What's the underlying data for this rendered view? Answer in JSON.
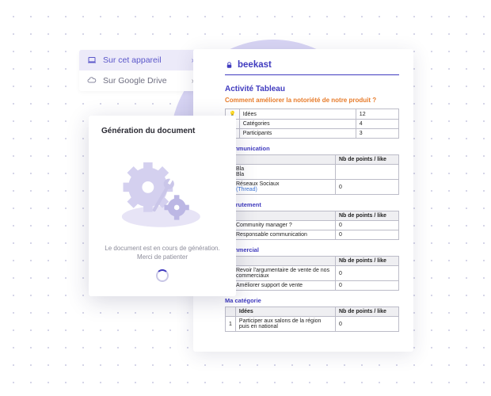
{
  "export": {
    "device_label": "Sur cet appareil",
    "drive_label": "Sur Google Drive"
  },
  "brand": "beekast",
  "activity": {
    "title": "Activité Tableau",
    "question": "Comment améliorer la notoriété de notre produit ?",
    "summary": [
      {
        "label": "Idées",
        "value": "12"
      },
      {
        "label": "Catégories",
        "value": "4"
      },
      {
        "label": "Participants",
        "value": "3"
      }
    ],
    "points_col": "Nb de points / like",
    "idea_col": "Idées",
    "categories": [
      {
        "name": "Communication",
        "rows": [
          {
            "idea": "Bla\nBla",
            "points": ""
          },
          {
            "idea": "Réseaux Sociaux",
            "points": "0",
            "link": "(Thread)"
          }
        ]
      },
      {
        "name": "Recrutement",
        "rows": [
          {
            "idea": "Community manager ?",
            "points": "0"
          },
          {
            "idea": "Responsable communication",
            "points": "0"
          }
        ]
      },
      {
        "name": "Commercial",
        "rows": [
          {
            "idea": "Revoir l'argumentaire de vente de nos commerciaux",
            "points": "0"
          },
          {
            "idea": "Améliorer support de vente",
            "points": "0"
          }
        ]
      },
      {
        "name": "Ma catégorie",
        "rows": [
          {
            "idea": "Participer aux salons de la région puis en national",
            "points": "0"
          }
        ]
      }
    ]
  },
  "modal": {
    "title": "Génération du document",
    "line1": "Le document est en cours de génération.",
    "line2": "Merci de patienter"
  }
}
